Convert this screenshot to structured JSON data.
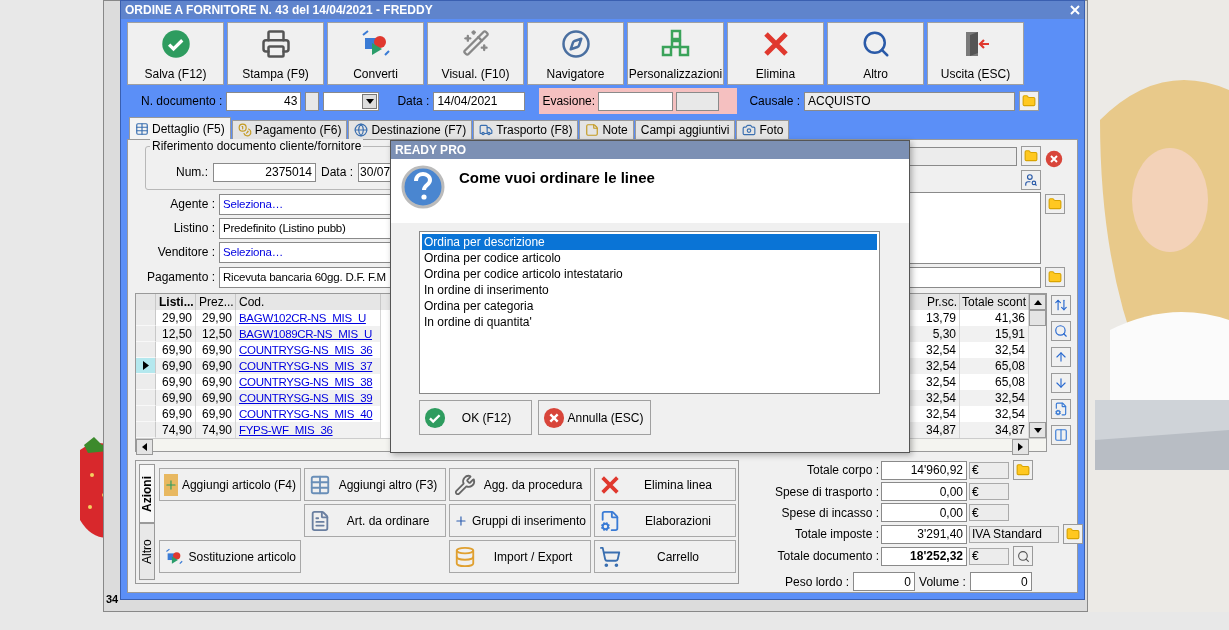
{
  "back_window": {
    "footer": "34"
  },
  "window": {
    "title": "ORDINE A FORNITORE N. 43 del 14/04/2021 - FREDDY"
  },
  "toolbar": [
    "Salva (F12)",
    "Stampa (F9)",
    "Converti",
    "Visual. (F10)",
    "Navigatore",
    "Personalizzazioni",
    "Elimina",
    "Altro",
    "Uscita (ESC)"
  ],
  "header": {
    "doc_number_label": "N. documento :",
    "doc_number": "43",
    "date_label": "Data :",
    "date": "14/04/2021",
    "evasione_label": "Evasione:",
    "causale_label": "Causale :",
    "causale": "ACQUISTO"
  },
  "tabs": [
    {
      "label": "Dettaglio (F5)",
      "selected": true
    },
    {
      "label": "Pagamento (F6)",
      "selected": false
    },
    {
      "label": "Destinazione (F7)",
      "selected": false
    },
    {
      "label": "Trasporto (F8)",
      "selected": false
    },
    {
      "label": "Note",
      "selected": false
    },
    {
      "label": "Campi aggiuntivi",
      "selected": false
    },
    {
      "label": "Foto",
      "selected": false
    }
  ],
  "reference": {
    "legend": "Riferimento documento cliente/fornitore",
    "num_label": "Num.:",
    "num": "2375014",
    "date_label": "Data :",
    "date": "30/07"
  },
  "form_fields": [
    {
      "label": "Agente :",
      "value": "Seleziona…",
      "kind": "select"
    },
    {
      "label": "Listino :",
      "value": "Predefinito (Listino pubb)",
      "kind": "text"
    },
    {
      "label": "Venditore :",
      "value": "Seleziona…",
      "kind": "select"
    },
    {
      "label": "Pagamento :",
      "value": "Ricevuta bancaria 60gg. D.F. F.M",
      "kind": "text"
    }
  ],
  "table": {
    "columns": [
      "Listi...",
      "Prez...",
      "Cod.",
      "Pr.sc.",
      "Totale scont"
    ],
    "rows": [
      {
        "list": "29,90",
        "price": "29,90",
        "code": "BAGW102CR-NS_MIS_U",
        "net_price": "13,79",
        "total": "41,36",
        "selected": false
      },
      {
        "list": "12,50",
        "price": "12,50",
        "code": "BAGW1089CR-NS_MIS_U",
        "net_price": "5,30",
        "total": "15,91",
        "selected": false
      },
      {
        "list": "69,90",
        "price": "69,90",
        "code": "COUNTRYSG-NS_MIS_36",
        "net_price": "32,54",
        "total": "32,54",
        "selected": false
      },
      {
        "list": "69,90",
        "price": "69,90",
        "code": "COUNTRYSG-NS_MIS_37",
        "net_price": "32,54",
        "total": "65,08",
        "selected": true
      },
      {
        "list": "69,90",
        "price": "69,90",
        "code": "COUNTRYSG-NS_MIS_38",
        "net_price": "32,54",
        "total": "65,08",
        "selected": false
      },
      {
        "list": "69,90",
        "price": "69,90",
        "code": "COUNTRYSG-NS_MIS_39",
        "net_price": "32,54",
        "total": "32,54",
        "selected": false
      },
      {
        "list": "69,90",
        "price": "69,90",
        "code": "COUNTRYSG-NS_MIS_40",
        "net_price": "32,54",
        "total": "32,54",
        "selected": false
      },
      {
        "list": "74,90",
        "price": "74,90",
        "code": "FYPS-WF_MIS_36",
        "net_price": "34,87",
        "total": "34,87",
        "selected": false
      }
    ]
  },
  "actions": {
    "tabs": [
      {
        "label": "Azioni",
        "selected": true
      },
      {
        "label": "Altro",
        "selected": false
      }
    ],
    "rows": [
      [
        "Aggiungi articolo (F4)",
        "Aggiungi altro (F3)",
        "Agg. da procedura",
        "Elimina linea"
      ],
      [
        null,
        "Art. da ordinare",
        "Gruppi di inserimento",
        "Elaborazioni"
      ],
      [
        "Sostituzione articolo",
        null,
        "Import / Export",
        "Carrello"
      ]
    ]
  },
  "totals": [
    {
      "label": "Totale corpo :",
      "value": "14'960,92",
      "unit": "€",
      "kind": "line"
    },
    {
      "label": "Spese di trasporto :",
      "value": "0,00",
      "unit": "€",
      "kind": "line"
    },
    {
      "label": "Spese di incasso :",
      "value": "0,00",
      "unit": "€",
      "kind": "line"
    },
    {
      "label": "Totale imposte :",
      "value": "3'291,40",
      "unit": "IVA Standard",
      "kind": "line"
    },
    {
      "label": "Totale documento :",
      "value": "18'252,32",
      "unit": "€",
      "kind": "total"
    }
  ],
  "weights": [
    {
      "label": "Peso lordo :",
      "value": "0"
    },
    {
      "label": "Volume :",
      "value": "0"
    }
  ],
  "dialog": {
    "title": "READY PRO",
    "question": "Come vuoi ordinare le linee",
    "options": [
      {
        "label": "Ordina per descrizione",
        "selected": true
      },
      {
        "label": "Ordina per codice articolo",
        "selected": false
      },
      {
        "label": "Ordina per codice articolo intestatario",
        "selected": false
      },
      {
        "label": "In ordine di inserimento",
        "selected": false
      },
      {
        "label": "Ordina per categoria",
        "selected": false
      },
      {
        "label": "In ordine di quantita'",
        "selected": false
      }
    ],
    "buttons": [
      "OK (F12)",
      "Annulla (ESC)"
    ]
  }
}
